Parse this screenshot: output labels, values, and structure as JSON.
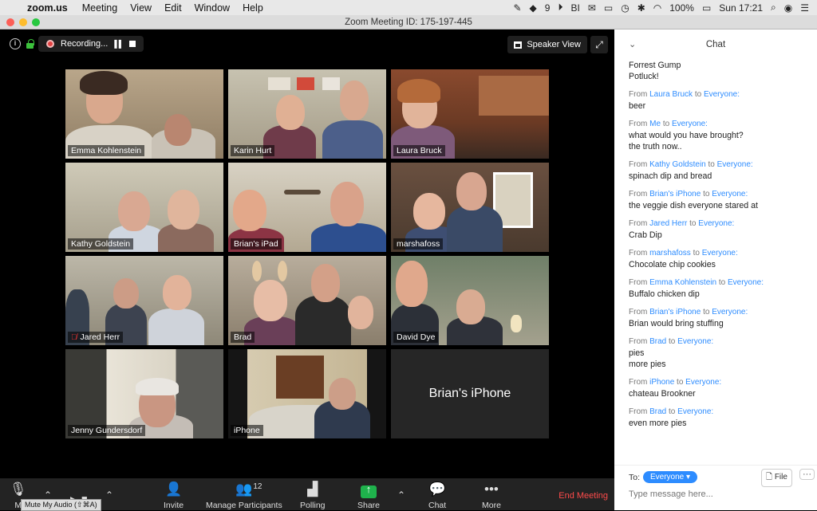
{
  "menubar": {
    "apple_icon": "apple-icon",
    "app_name": "zoom.us",
    "items": [
      "Meeting",
      "View",
      "Edit",
      "Window",
      "Help"
    ],
    "tray": {
      "dropbox_count": "9",
      "battery": "100%",
      "clock": "Sun 17:21"
    }
  },
  "window": {
    "title": "Zoom Meeting ID: 175-197-445"
  },
  "stage": {
    "recording_label": "Recording...",
    "speaker_view_label": "Speaker View"
  },
  "tiles": [
    {
      "name": "Emma Kohlenstein",
      "active": true,
      "muted": false
    },
    {
      "name": "Karin Hurt",
      "active": false,
      "muted": false
    },
    {
      "name": "Laura Bruck",
      "active": false,
      "muted": false
    },
    {
      "name": "Kathy Goldstein",
      "active": false,
      "muted": false
    },
    {
      "name": "Brian's iPad",
      "active": false,
      "muted": false
    },
    {
      "name": "marshafoss",
      "active": false,
      "muted": false
    },
    {
      "name": "Jared Herr",
      "active": false,
      "muted": true
    },
    {
      "name": "Brad",
      "active": false,
      "muted": false
    },
    {
      "name": "David Dye",
      "active": false,
      "muted": false
    },
    {
      "name": "Jenny Gundersdorf",
      "active": false,
      "muted": false
    },
    {
      "name": "iPhone",
      "active": false,
      "muted": false
    },
    {
      "name": "Brian's iPhone",
      "active": false,
      "muted": false,
      "video_off": true
    }
  ],
  "toolbar": {
    "mute_short": "M",
    "mute_tooltip": "Mute My Audio (⇧⌘A)",
    "invite": "Invite",
    "manage_participants": "Manage Participants",
    "participant_count": "12",
    "polling": "Polling",
    "share": "Share",
    "chat": "Chat",
    "more": "More",
    "end_meeting": "End Meeting"
  },
  "chat": {
    "title": "Chat",
    "messages": [
      {
        "from": "",
        "to": "",
        "lines": [
          "Forrest Gump",
          "Potluck!"
        ]
      },
      {
        "from": "Laura Bruck",
        "to": "Everyone:",
        "lines": [
          "beer"
        ]
      },
      {
        "from": "Me",
        "to": "Everyone:",
        "lines": [
          "what would you have brought?",
          "the truth now.."
        ]
      },
      {
        "from": "Kathy Goldstein",
        "to": "Everyone:",
        "lines": [
          "spinach dip and bread"
        ]
      },
      {
        "from": "Brian's iPhone",
        "to": "Everyone:",
        "lines": [
          "the veggie dish everyone stared at"
        ]
      },
      {
        "from": "Jared Herr",
        "to": "Everyone:",
        "lines": [
          "Crab Dip"
        ]
      },
      {
        "from": "marshafoss",
        "to": "Everyone:",
        "lines": [
          "Chocolate chip cookies"
        ]
      },
      {
        "from": "Emma Kohlenstein",
        "to": "Everyone:",
        "lines": [
          "Buffalo chicken dip"
        ]
      },
      {
        "from": "Brian's iPhone",
        "to": "Everyone:",
        "lines": [
          "Brian would bring stuffing"
        ]
      },
      {
        "from": "Brad",
        "to": "Everyone:",
        "lines": [
          "pies",
          "more pies"
        ]
      },
      {
        "from": "iPhone",
        "to": "Everyone:",
        "lines": [
          "chateau Brookner"
        ]
      },
      {
        "from": "Brad",
        "to": "Everyone:",
        "lines": [
          "even more pies"
        ]
      }
    ],
    "from_prefix": "From",
    "to_word": "to",
    "to_label": "To:",
    "recipient": "Everyone",
    "file_label": "File",
    "input_placeholder": "Type message here..."
  }
}
